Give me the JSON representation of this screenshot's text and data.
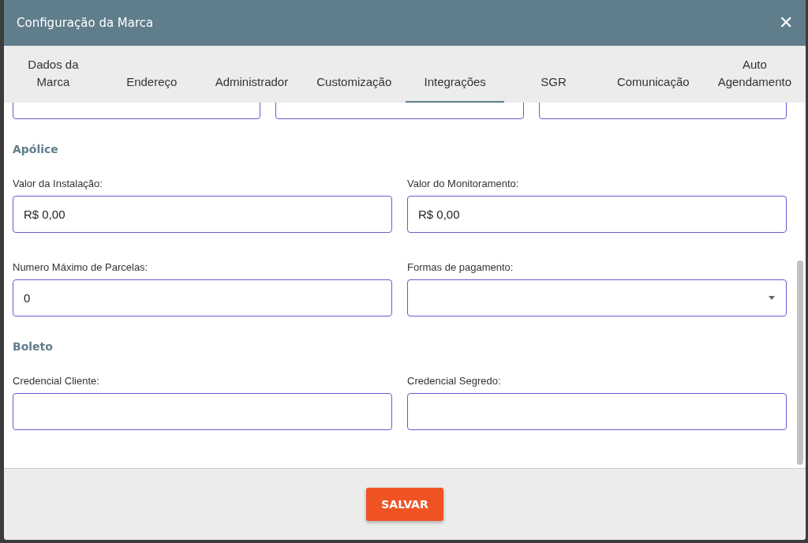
{
  "window": {
    "title": "Configuração da Marca",
    "close": "✕"
  },
  "tabs": [
    {
      "label": "Dados da Marca",
      "selected": false
    },
    {
      "label": "Endereço",
      "selected": false
    },
    {
      "label": "Administrador",
      "selected": false
    },
    {
      "label": "Customização",
      "selected": false
    },
    {
      "label": "Integrações",
      "selected": true
    },
    {
      "label": "SGR",
      "selected": false
    },
    {
      "label": "Comunicação",
      "selected": false
    },
    {
      "label": "Auto Agendamento",
      "selected": false
    }
  ],
  "partial_fields_count_row": [
    {
      "kind": "text"
    },
    {
      "kind": "text"
    },
    {
      "kind": "text"
    }
  ],
  "sections": [
    {
      "title": "Apólice",
      "fields": [
        {
          "kind": "text",
          "label": "Valor da Instalação:",
          "value": "R$ 0,00"
        },
        {
          "kind": "text",
          "label": "Valor do Monitoramento:",
          "value": "R$ 0,00"
        },
        {
          "kind": "text",
          "label": "Numero Máximo de Parcelas:",
          "value": "0"
        },
        {
          "kind": "select",
          "label": "Formas de pagamento:"
        }
      ]
    },
    {
      "title": "Boleto",
      "fields": [
        {
          "kind": "text",
          "label": "Credencial Cliente:"
        },
        {
          "kind": "text",
          "label": "Credencial Segredo:"
        }
      ]
    }
  ],
  "save_button": "SALVAR"
}
